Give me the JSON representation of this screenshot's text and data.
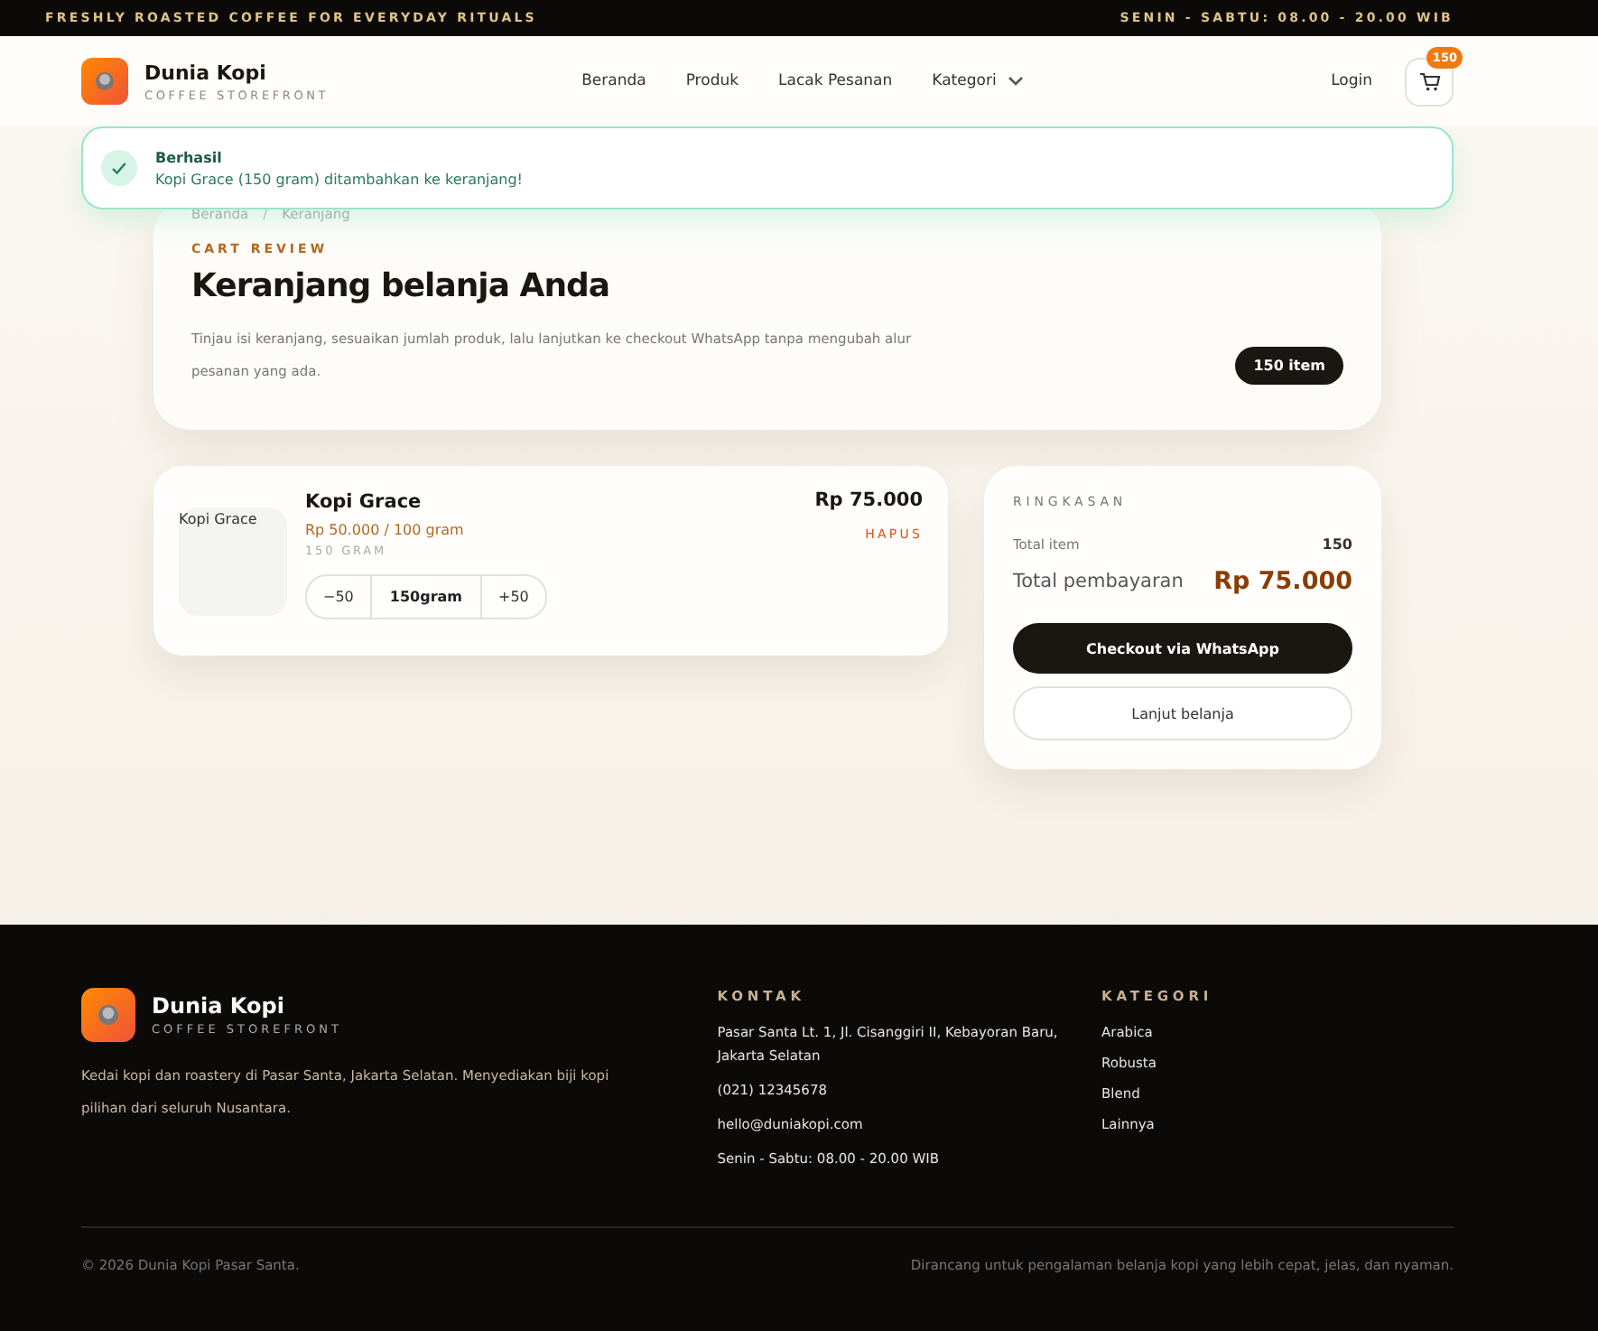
{
  "topbar": {
    "tagline": "FRESHLY ROASTED COFFEE FOR EVERYDAY RITUALS",
    "hours": "SENIN - SABTU: 08.00 - 20.00 WIB"
  },
  "brand": {
    "name": "Dunia Kopi",
    "subtitle": "COFFEE STOREFRONT"
  },
  "nav": [
    {
      "label": "Beranda",
      "kind": "link"
    },
    {
      "label": "Produk",
      "kind": "link"
    },
    {
      "label": "Lacak Pesanan",
      "kind": "link"
    },
    {
      "label": "Kategori",
      "kind": "dropdown"
    }
  ],
  "login": "Login",
  "cart_badge": "150",
  "toast": {
    "title": "Berhasil",
    "message": "Kopi Grace (150 gram) ditambahkan ke keranjang!"
  },
  "breadcrumb": [
    "Beranda",
    "Keranjang"
  ],
  "breadcrumb_separator": "/",
  "hero": {
    "eyebrow": "CART REVIEW",
    "title": "Keranjang belanja Anda",
    "description": "Tinjau isi keranjang, sesuaikan jumlah produk, lalu lanjutkan ke checkout WhatsApp tanpa mengubah alur pesanan yang ada.",
    "count": "150 item"
  },
  "cart_items": [
    {
      "image_alt": "Kopi Grace",
      "name": "Kopi Grace",
      "price_unit": "Rp 50.000 / 100 gram",
      "weight": "150 GRAM",
      "total": "Rp 75.000",
      "remove": "HAPUS",
      "decrease": "−50",
      "quantity": "150gram",
      "increase": "+50"
    }
  ],
  "summary": {
    "heading": "RINGKASAN",
    "total_items_label": "Total item",
    "total_items": "150",
    "total_label": "Total pembayaran",
    "total": "Rp 75.000",
    "checkout": "Checkout via WhatsApp",
    "continue": "Lanjut belanja"
  },
  "footer": {
    "brand": "Dunia Kopi",
    "subtitle": "COFFEE STOREFRONT",
    "about": "Kedai kopi dan roastery di Pasar Santa, Jakarta Selatan. Menyediakan biji kopi pilihan dari seluruh Nusantara.",
    "contact_heading": "KONTAK",
    "contact": [
      "Pasar Santa Lt. 1, Jl. Cisanggiri II, Kebayoran Baru, Jakarta Selatan",
      "(021) 12345678",
      "hello@duniakopi.com",
      "Senin - Sabtu: 08.00 - 20.00 WIB"
    ],
    "category_heading": "KATEGORI",
    "categories": [
      "Arabica",
      "Robusta",
      "Blend",
      "Lainnya"
    ],
    "copyright": "© 2026 Dunia Kopi Pasar Santa.",
    "tagline": "Dirancang untuk pengalaman belanja kopi yang lebih cepat, jelas, dan nyaman."
  }
}
